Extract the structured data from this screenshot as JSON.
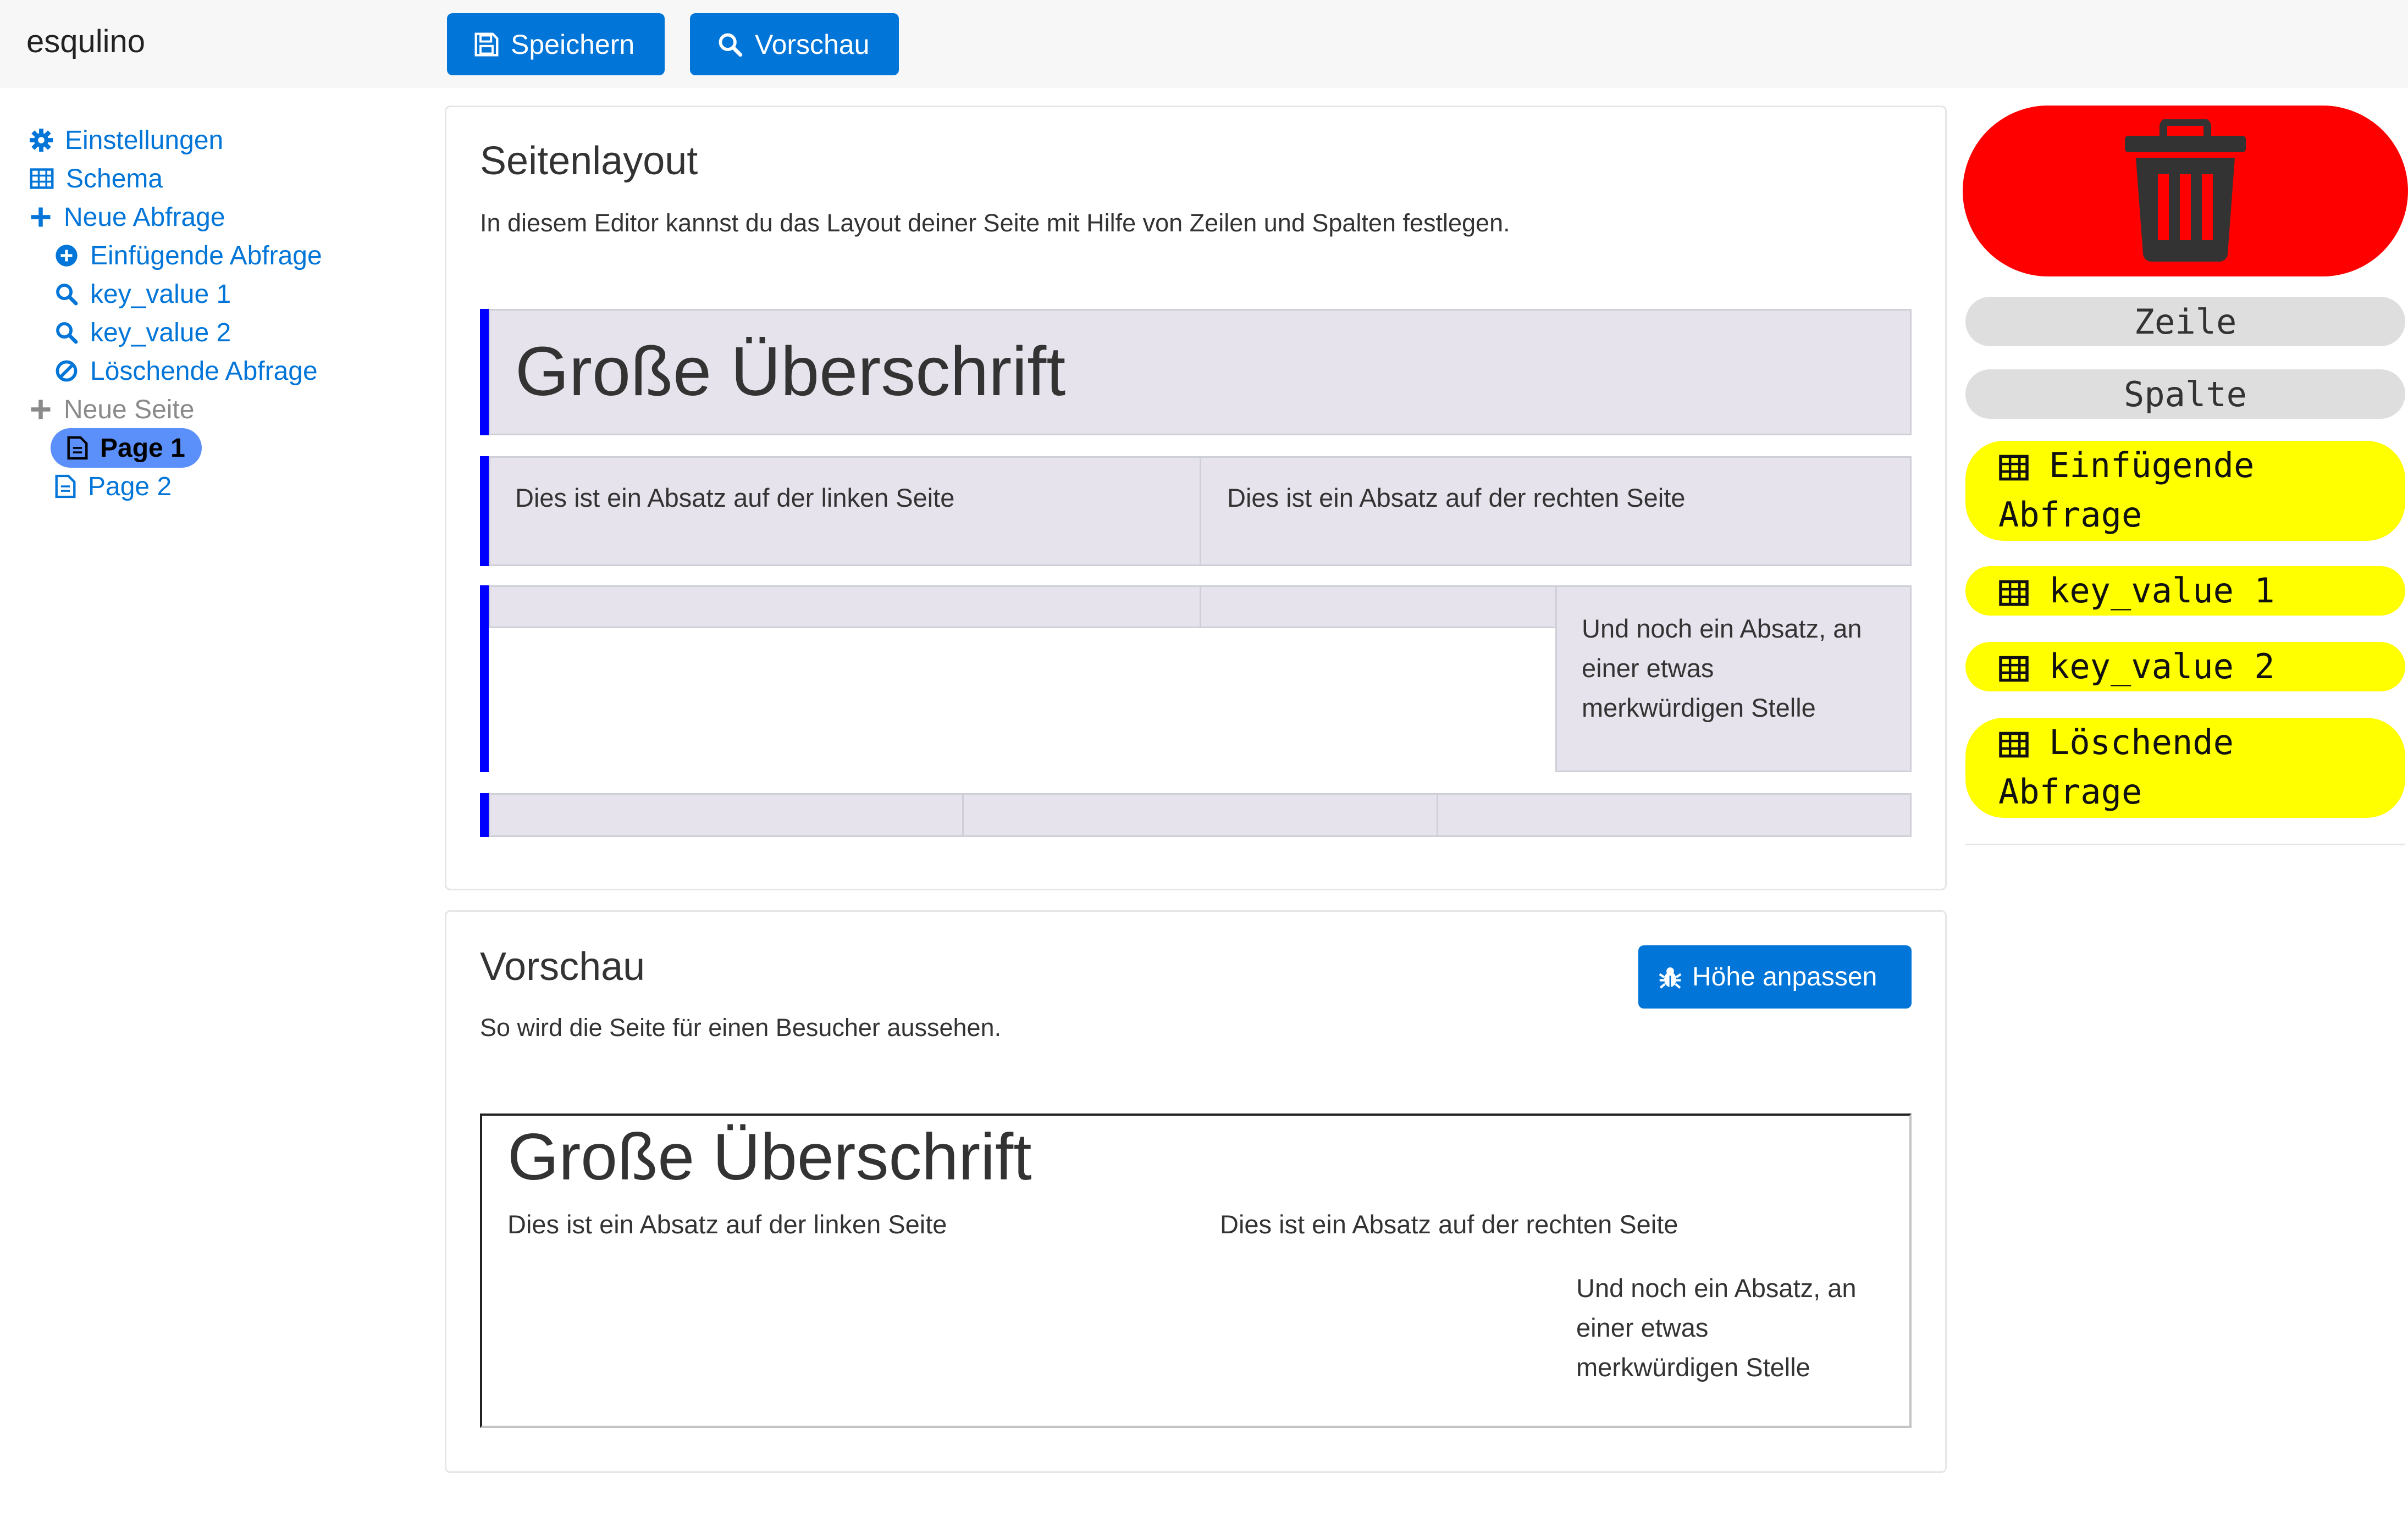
{
  "app": {
    "brand": "esqulino"
  },
  "toolbar": {
    "save_label": "Speichern",
    "preview_label": "Vorschau"
  },
  "sidebar": {
    "items": [
      {
        "label": "Einstellungen",
        "icon": "gear-icon"
      },
      {
        "label": "Schema",
        "icon": "table-icon"
      },
      {
        "label": "Neue Abfrage",
        "icon": "plus-icon"
      },
      {
        "label": "Einfügende Abfrage",
        "icon": "plus-circle-icon"
      },
      {
        "label": "key_value 1",
        "icon": "search-icon"
      },
      {
        "label": "key_value 2",
        "icon": "search-icon"
      },
      {
        "label": "Löschende Abfrage",
        "icon": "ban-icon"
      },
      {
        "label": "Neue Seite",
        "icon": "plus-icon"
      },
      {
        "label": "Page 1",
        "icon": "file-icon",
        "active": true
      },
      {
        "label": "Page 2",
        "icon": "file-icon"
      }
    ]
  },
  "layout_card": {
    "title": "Seitenlayout",
    "description": "In diesem Editor kannst du das Layout deiner Seite mit Hilfe von Zeilen und Spalten festlegen.",
    "heading": "Große Überschrift",
    "left_paragraph": "Dies ist ein Absatz auf der linken Seite",
    "right_paragraph": "Dies ist ein Absatz auf der rechten Seite",
    "odd_paragraph_lines": [
      "Und noch ein Absatz, an",
      "einer etwas",
      "merkwürdigen Stelle"
    ]
  },
  "preview_card": {
    "title": "Vorschau",
    "description": "So wird die Seite für einen Besucher aussehen.",
    "adjust_button": "Höhe anpassen",
    "heading": "Große Überschrift",
    "left_paragraph": "Dies ist ein Absatz auf der linken Seite",
    "right_paragraph": "Dies ist ein Absatz auf der rechten Seite",
    "odd_paragraph_lines": [
      "Und noch ein Absatz, an",
      "einer etwas",
      "merkwürdigen Stelle"
    ]
  },
  "palette": {
    "trash_icon": "trash-icon",
    "row_label": "Zeile",
    "column_label": "Spalte",
    "queries": [
      {
        "line1": "Einfügende",
        "line2": "Abfrage"
      },
      {
        "line1": "key_value 1",
        "line2": ""
      },
      {
        "line1": "key_value 2",
        "line2": ""
      },
      {
        "line1": "Löschende",
        "line2": "Abfrage"
      }
    ]
  },
  "colors": {
    "accent": "#0275d8",
    "row_marker": "#0000ff",
    "trash_bg": "#ff0000",
    "query_bg": "#ffff00"
  }
}
